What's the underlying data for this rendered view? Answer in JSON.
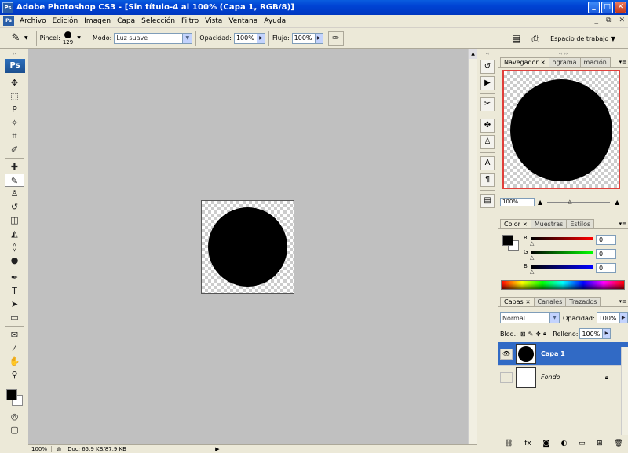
{
  "window": {
    "title": "Adobe Photoshop CS3 - [Sin título-4 al 100% (Capa 1, RGB/8)]",
    "app_icon": "Ps",
    "minimize": "_",
    "maximize": "□",
    "close": "✕"
  },
  "menu": {
    "items": [
      "Archivo",
      "Edición",
      "Imagen",
      "Capa",
      "Selección",
      "Filtro",
      "Vista",
      "Ventana",
      "Ayuda"
    ],
    "doc_min": "_",
    "doc_restore": "⧉",
    "doc_close": "✕"
  },
  "options": {
    "brush_label": "Pincel:",
    "brush_size": "129",
    "mode_label": "Modo:",
    "mode_value": "Luz suave",
    "opacity_label": "Opacidad:",
    "opacity_value": "100%",
    "flow_label": "Flujo:",
    "flow_value": "100%",
    "workspace_label": "Espacio de trabajo"
  },
  "toolbox": {
    "logo": "Ps"
  },
  "status": {
    "zoom": "100%",
    "doc": "Doc: 65,9 KB/87,9 KB"
  },
  "navigator": {
    "tabs": [
      {
        "label": "Navegador",
        "close": "✕"
      },
      {
        "label": "ograma"
      },
      {
        "label": "mación"
      }
    ],
    "zoom": "100%"
  },
  "color": {
    "tabs": [
      {
        "label": "Color",
        "close": "✕"
      },
      {
        "label": "Muestras"
      },
      {
        "label": "Estilos"
      }
    ],
    "channels": [
      {
        "label": "R",
        "value": "0"
      },
      {
        "label": "G",
        "value": "0"
      },
      {
        "label": "B",
        "value": "0"
      }
    ]
  },
  "layers": {
    "tabs": [
      {
        "label": "Capas",
        "close": "✕"
      },
      {
        "label": "Canales"
      },
      {
        "label": "Trazados"
      }
    ],
    "blend_mode": "Normal",
    "opacity_label": "Opacidad:",
    "opacity_value": "100%",
    "lock_label": "Bloq.:",
    "fill_label": "Relleno:",
    "fill_value": "100%",
    "list": [
      {
        "name": "Capa 1"
      },
      {
        "name": "Fondo"
      }
    ]
  },
  "colors": {
    "title_bar": "#0a5ddf",
    "selected_layer": "#316ac5",
    "canvas_bg": "#c0c0c0",
    "navigator_frame": "#e0403c"
  }
}
